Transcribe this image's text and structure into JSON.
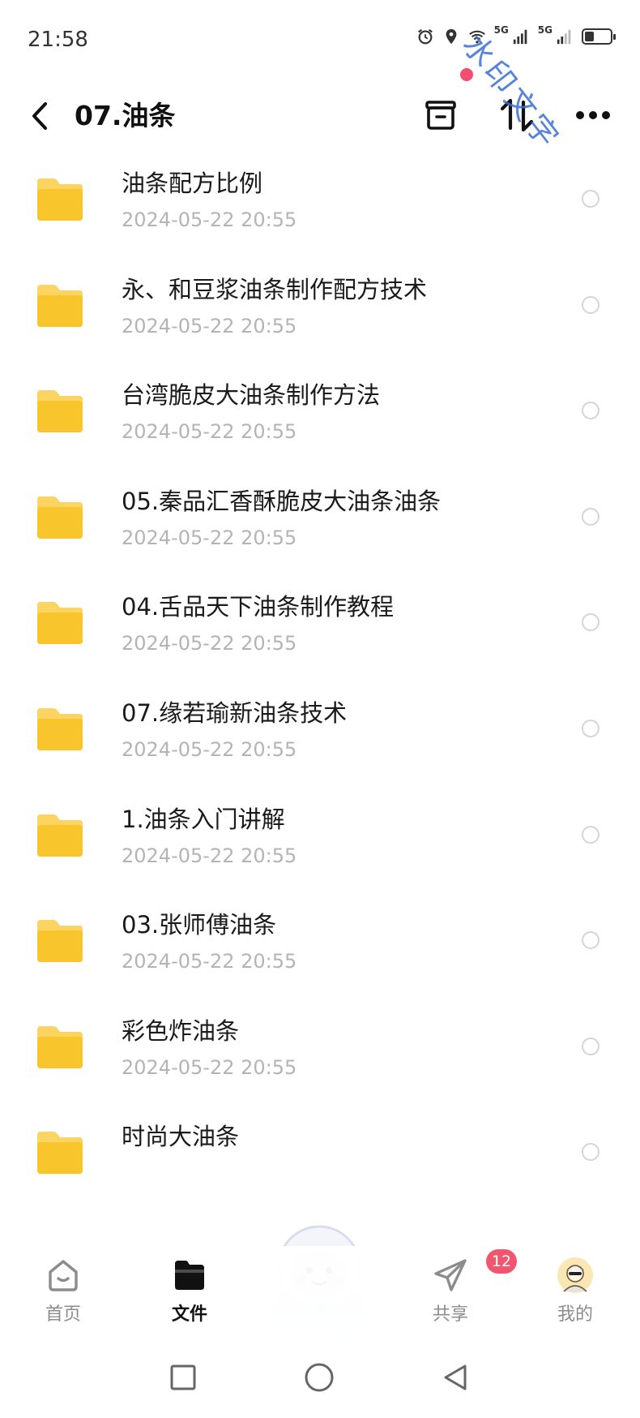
{
  "status_bar": {
    "time": "21:58",
    "icons": [
      "alarm-icon",
      "location-icon",
      "wifi-icon",
      "signal-5g-icon",
      "signal-5g-icon",
      "battery-icon"
    ],
    "network_labels": [
      "5G",
      "5G"
    ],
    "battery_level": 0.35
  },
  "header": {
    "title": "07.油条",
    "icons": [
      "back-icon",
      "box-icon",
      "sort-icon",
      "more-icon"
    ],
    "watermark": "水印文字",
    "accent_dot_color": "#f0506e"
  },
  "files": [
    {
      "name": "油条配方比例",
      "date": "2024-05-22  20:55"
    },
    {
      "name": "永、和豆浆油条制作配方技术",
      "date": "2024-05-22  20:55"
    },
    {
      "name": "台湾脆皮大油条制作方法",
      "date": "2024-05-22  20:55"
    },
    {
      "name": "05.秦品汇香酥脆皮大油条油条",
      "date": "2024-05-22  20:55"
    },
    {
      "name": "04.舌品天下油条制作教程",
      "date": "2024-05-22  20:55"
    },
    {
      "name": "07.缘若瑜新油条技术",
      "date": "2024-05-22  20:55"
    },
    {
      "name": "1.油条入门讲解",
      "date": "2024-05-22  20:55"
    },
    {
      "name": "03.张师傅油条",
      "date": "2024-05-22  20:55"
    },
    {
      "name": "彩色炸油条",
      "date": "2024-05-22  20:55"
    },
    {
      "name": "时尚大油条",
      "date": ""
    }
  ],
  "folder_color": "#f9c52c",
  "bottom_nav": {
    "items": [
      {
        "label": "首页",
        "icon": "home-icon"
      },
      {
        "label": "文件",
        "icon": "folder-icon",
        "active": true
      },
      {
        "label": "共享",
        "icon": "paper-plane-icon",
        "badge": "12"
      },
      {
        "label": "我的",
        "icon": "avatar-icon"
      }
    ],
    "center_icon": "mascot-icon"
  },
  "system_nav": [
    "recent-apps-icon",
    "home-circle-icon",
    "back-triangle-icon"
  ]
}
